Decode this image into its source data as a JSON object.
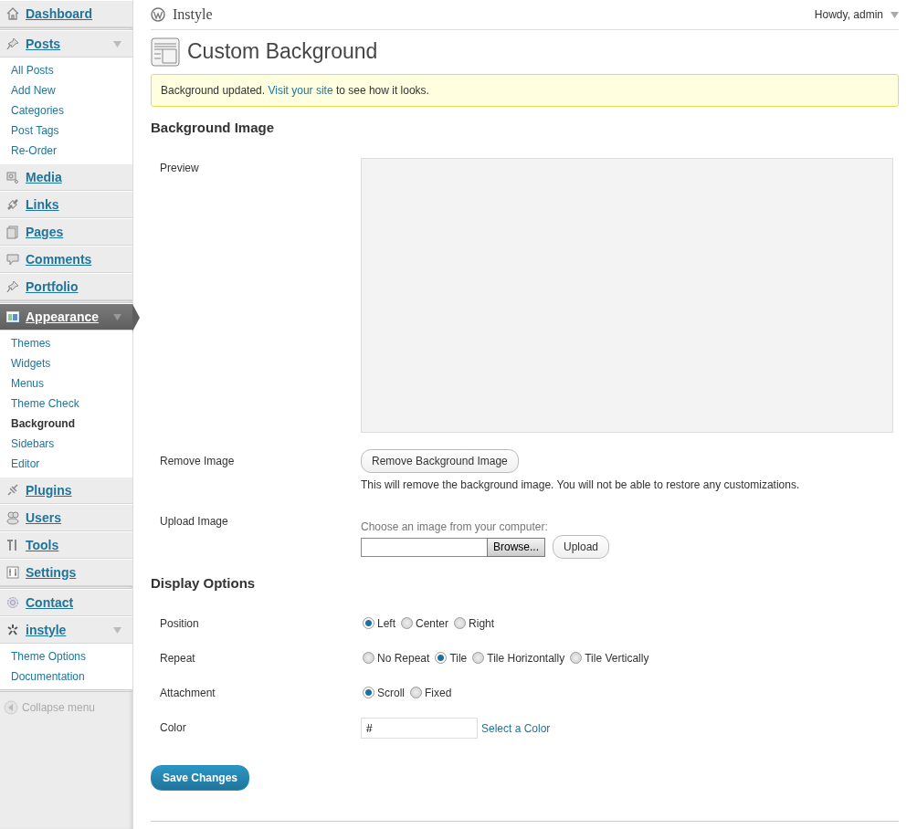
{
  "sidebar": {
    "groups": [
      {
        "items": [
          {
            "label": "Dashboard",
            "selected": false
          }
        ]
      },
      {
        "items": [
          {
            "label": "Posts",
            "selected": false,
            "children": [
              {
                "label": "All Posts",
                "selected": false
              },
              {
                "label": "Add New",
                "selected": false
              },
              {
                "label": "Categories",
                "selected": false
              },
              {
                "label": "Post Tags",
                "selected": false
              },
              {
                "label": "Re-Order",
                "selected": false
              }
            ]
          },
          {
            "label": "Media",
            "selected": false
          },
          {
            "label": "Links",
            "selected": false
          },
          {
            "label": "Pages",
            "selected": false
          },
          {
            "label": "Comments",
            "selected": false
          },
          {
            "label": "Portfolio",
            "selected": false
          }
        ]
      },
      {
        "items": [
          {
            "label": "Appearance",
            "selected": true,
            "children": [
              {
                "label": "Themes",
                "selected": false
              },
              {
                "label": "Widgets",
                "selected": false
              },
              {
                "label": "Menus",
                "selected": false
              },
              {
                "label": "Theme Check",
                "selected": false
              },
              {
                "label": "Background",
                "selected": true
              },
              {
                "label": "Sidebars",
                "selected": false
              },
              {
                "label": "Editor",
                "selected": false
              }
            ]
          },
          {
            "label": "Plugins",
            "selected": false
          },
          {
            "label": "Users",
            "selected": false
          },
          {
            "label": "Tools",
            "selected": false
          },
          {
            "label": "Settings",
            "selected": false
          }
        ]
      },
      {
        "items": [
          {
            "label": "Contact",
            "selected": false
          },
          {
            "label": "instyle",
            "selected": false,
            "children": [
              {
                "label": "Theme Options",
                "selected": false
              },
              {
                "label": "Documentation",
                "selected": false
              }
            ]
          }
        ]
      }
    ],
    "collapse": "Collapse menu"
  },
  "header": {
    "site_title": "Instyle",
    "user": "Howdy, admin"
  },
  "page_title": "Custom Background",
  "notice": {
    "before": "Background updated.",
    "link": "Visit your site",
    "after": "to see how it looks."
  },
  "background_image": {
    "heading": "Background Image",
    "preview_label": "Preview",
    "remove_label": "Remove Image",
    "remove_button": "Remove Background Image",
    "remove_note": "This will remove the background image. You will not be able to restore any customizations.",
    "upload_label": "Upload Image",
    "upload_hint": "Choose an image from your computer:",
    "browse_button": "Browse...",
    "upload_button": "Upload"
  },
  "display_options": {
    "heading": "Display Options",
    "rows": [
      {
        "label": "Position",
        "options": [
          {
            "label": "Left",
            "selected": true
          },
          {
            "label": "Center",
            "selected": false
          },
          {
            "label": "Right",
            "selected": false
          }
        ]
      },
      {
        "label": "Repeat",
        "options": [
          {
            "label": "No Repeat",
            "selected": false
          },
          {
            "label": "Tile",
            "selected": true
          },
          {
            "label": "Tile Horizontally",
            "selected": false
          },
          {
            "label": "Tile Vertically",
            "selected": false
          }
        ]
      },
      {
        "label": "Attachment",
        "options": [
          {
            "label": "Scroll",
            "selected": true
          },
          {
            "label": "Fixed",
            "selected": false
          }
        ]
      }
    ],
    "color": {
      "label": "Color",
      "value": "#",
      "link": "Select a Color"
    }
  },
  "save_button": "Save Changes"
}
